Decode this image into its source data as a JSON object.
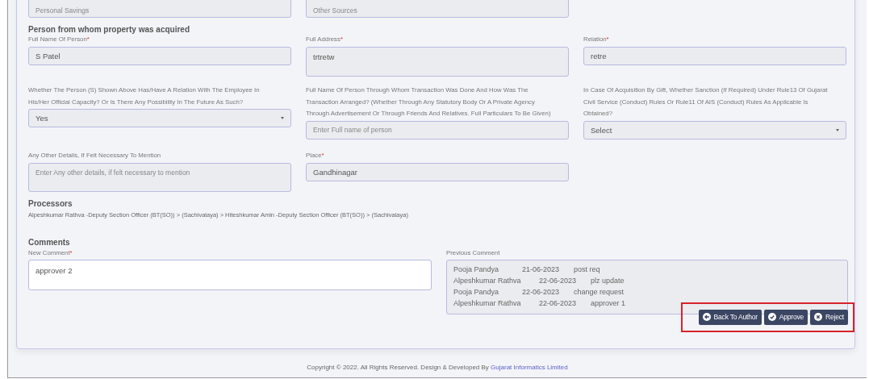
{
  "top_fields": [
    {
      "placeholder": "Personal Savings"
    },
    {
      "placeholder": "Other Sources"
    }
  ],
  "section_title": "Person from whom property was acquired",
  "fields": [
    {
      "kind": "text",
      "label": "Full Name Of Person",
      "required_mark": "*",
      "value": "S Patel"
    },
    {
      "kind": "textarea",
      "label": "Full Address",
      "required_mark": "*",
      "value": "trtretw"
    },
    {
      "kind": "text",
      "label": "Relation",
      "required_mark": "*",
      "value": "retre"
    },
    {
      "kind": "select",
      "label": "Whether The Person (S) Shown Above Has/Have A Relation With The Employee In His/Her Official Capacity? Or Is There Any Possibility In The Future As Such?",
      "value": "Yes"
    },
    {
      "kind": "text",
      "label": "Full Name Of Person Through Whom Transaction Was Done And How Was The Transaction Arranged? (Whether Through Any Statutory Body Or A Private Agency Through Advertisement Or Through Friends And Relatives. Full Particulars To Be Given)",
      "placeholder": "Enter Full name of person"
    },
    {
      "kind": "select",
      "label": "In Case Of Acquisition By Gift, Whether Sanction (If Required) Under Rule13 Of Gujarat Civil Service (Conduct) Rules Or Rule11 Of AIS (Conduct) Rules As Applicable Is Obtained?",
      "value": "Select"
    },
    {
      "kind": "textarea",
      "label": "Any Other Details, If Felt Necessary To Mention",
      "placeholder": "Enter Any other details, if felt necessary to mention"
    },
    {
      "kind": "text",
      "label": "Place",
      "required_mark": "*",
      "value": "Gandhinagar"
    }
  ],
  "processors": {
    "title": "Processors",
    "text": "Alpeshkumar Rathva -Deputy Section Officer (BT(SO)) > (Sachivalaya) > Hiteshkumar Amin -Deputy Section Officer (BT(SO)) > (Sachivalaya)"
  },
  "comments": {
    "title": "Comments",
    "new_comment": {
      "label": "New Comment",
      "required_mark": "*",
      "value": "approver 2"
    },
    "previous_comment": {
      "label": "Previous Comment",
      "entries": [
        {
          "name": "Pooja Pandya",
          "date": "21-06-2023",
          "text": "post req"
        },
        {
          "name": "Alpeshkumar Rathva",
          "date": "22-06-2023",
          "text": "plz update"
        },
        {
          "name": "Pooja Pandya",
          "date": "22-06-2023",
          "text": "change request"
        },
        {
          "name": "Alpeshkumar Rathva",
          "date": "22-06-2023",
          "text": "approver 1"
        }
      ]
    }
  },
  "actions": {
    "highlighted": true,
    "buttons": [
      {
        "kind": "back",
        "label": "Back To Author"
      },
      {
        "kind": "approve",
        "label": "Approve"
      },
      {
        "kind": "reject",
        "label": "Reject"
      }
    ]
  },
  "footer": {
    "text": "Copyright © 2022. All Rights Reserved. Design & Developed By ",
    "link": "Gujarat Informatics Limited"
  }
}
